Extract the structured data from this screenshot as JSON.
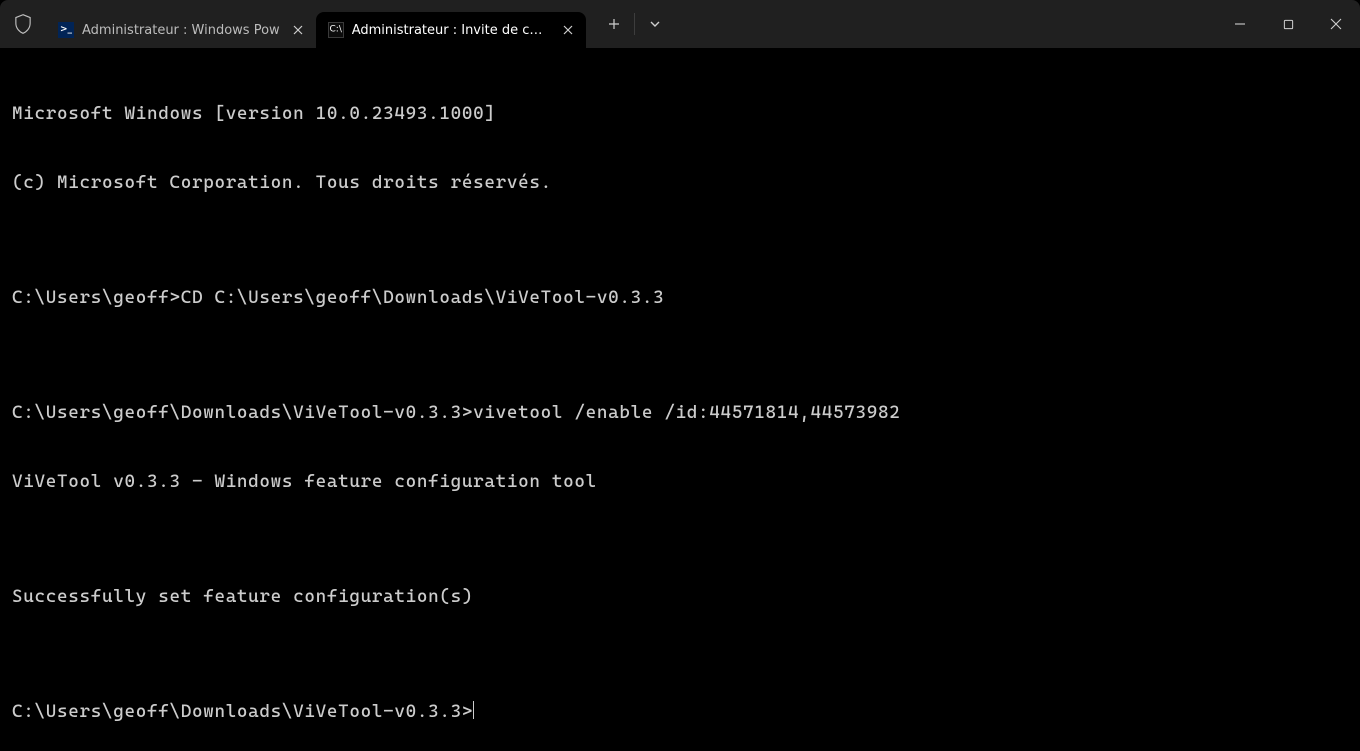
{
  "titlebar": {
    "tabs": [
      {
        "label": "Administrateur : Windows Pow",
        "icon": "ps",
        "active": false
      },
      {
        "label": "Administrateur : Invite de com",
        "icon": "cmd",
        "active": true
      }
    ]
  },
  "terminal": {
    "lines": [
      "Microsoft Windows [version 10.0.23493.1000]",
      "(c) Microsoft Corporation. Tous droits réservés.",
      "",
      "C:\\Users\\geoff>CD C:\\Users\\geoff\\Downloads\\ViVeTool-v0.3.3",
      "",
      "C:\\Users\\geoff\\Downloads\\ViVeTool-v0.3.3>vivetool /enable /id:44571814,44573982",
      "ViVeTool v0.3.3 - Windows feature configuration tool",
      "",
      "Successfully set feature configuration(s)",
      "",
      "C:\\Users\\geoff\\Downloads\\ViVeTool-v0.3.3>"
    ]
  }
}
